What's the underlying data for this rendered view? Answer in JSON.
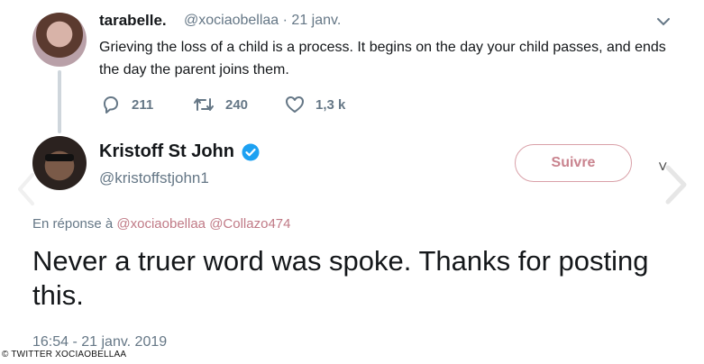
{
  "tweet1": {
    "name": "tarabelle.",
    "handle_date": "@xociaobellaa · 21 janv.",
    "text": "Grieving the loss of a child is a process. It begins on the day your child passes, and ends the day the parent joins them.",
    "stats": {
      "replies": "211",
      "retweets": "240",
      "likes": "1,3 k"
    }
  },
  "tweet2": {
    "name": "Kristoff St John",
    "handle": "@kristoffstjohn1",
    "follow_label": "Suivre",
    "reply_prefix": "En réponse à",
    "reply_mentions": "@xociaobellaa @Collazo474",
    "text": "Never a truer word was spoke. Thanks for posting this.",
    "timestamp": "16:54 - 21 janv. 2019"
  },
  "credit": "© TWITTER XOCIAOBELLAA",
  "colors": {
    "follow_border": "#d9a0a8",
    "follow_text": "#c9838e",
    "verified_blue": "#1da1f2",
    "mention": "#c07a86"
  },
  "icons": [
    "reply-icon",
    "retweet-icon",
    "like-icon",
    "verified-badge-icon",
    "chevron-down-icon",
    "caret-icon",
    "nav-next-icon",
    "nav-prev-icon"
  ]
}
